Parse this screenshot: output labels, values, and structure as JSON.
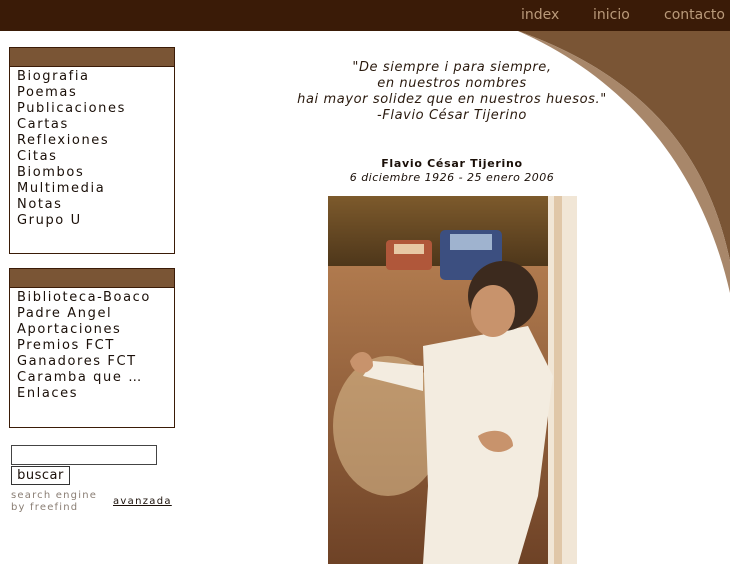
{
  "topnav": {
    "items": [
      "index",
      "inicio",
      "contacto"
    ]
  },
  "sidebar": {
    "menu1": [
      "Biografia",
      "Poemas",
      "Publicaciones",
      "Cartas",
      "Reflexiones",
      "Citas",
      "Biombos",
      "Multimedia",
      "Notas",
      "Grupo U"
    ],
    "menu2": [
      "Biblioteca-Boaco",
      "Padre Angel",
      "Aportaciones",
      "Premios FCT",
      "Ganadores FCT",
      "Caramba que …",
      "Enlaces"
    ]
  },
  "search": {
    "value": "",
    "button_label": "buscar",
    "engine_line1": "search engine",
    "engine_line2": "by freefind",
    "advanced_link": "avanzada"
  },
  "quote": {
    "lines": [
      "\"De siempre i para siempre,",
      "en nuestros nombres",
      "hai mayor solidez que en nuestros huesos.\"",
      "-Flavio César Tijerino"
    ]
  },
  "author": {
    "name": "Flavio César Tijerino",
    "dates": "6 diciembre 1926 - 25 enero 2006"
  },
  "colors": {
    "topbar": "#3a1b07",
    "nav_text": "#b99a7a",
    "box_header": "#7a5535",
    "arc_dark": "#7a5535",
    "arc_light": "#a8876a"
  }
}
